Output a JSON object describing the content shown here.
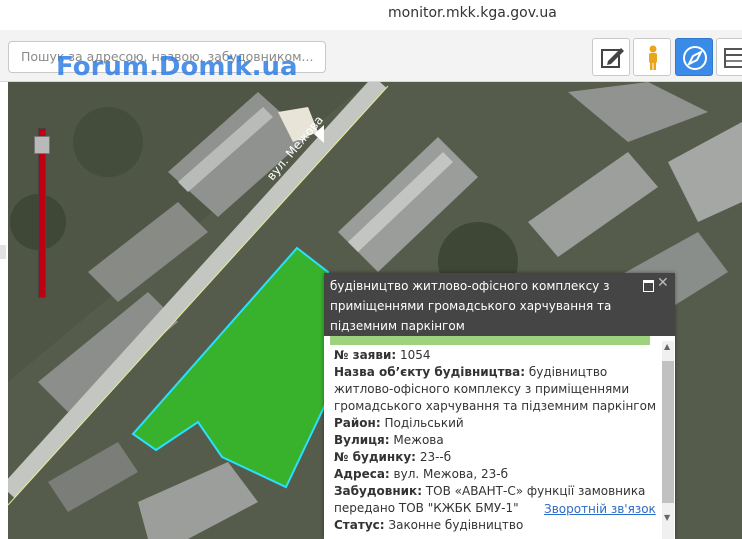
{
  "browser": {
    "url": "monitor.mkk.kga.gov.ua"
  },
  "toolbar": {
    "search_placeholder": "Пошук за адресою, назвою, забудовником...",
    "watermark": "Forum.Domik.ua",
    "buttons": [
      "edit-icon",
      "person-icon",
      "compass-icon",
      "table-icon"
    ],
    "dot_colors": [
      "#3b6fd8",
      "#d6c32a",
      "#d8344c"
    ]
  },
  "map": {
    "street_label": "вул. Межова",
    "polygon_color": "#35b82a",
    "polygon_outline": "#28e1ff"
  },
  "popup": {
    "title": "будівництво житлово-офісного комплексу з приміщеннями громадського харчування та підземним паркінгом",
    "fields": [
      {
        "label": "№ заяви:",
        "value": "1054"
      },
      {
        "label": "Назва об’єкту будівництва:",
        "value": "будівництво житлово-офісного комплексу з приміщеннями громадського харчування та підземним паркінгом"
      },
      {
        "label": "Район:",
        "value": "Подільський"
      },
      {
        "label": "Вулиця:",
        "value": "Межова"
      },
      {
        "label": "№ будинку:",
        "value": "23--б"
      },
      {
        "label": "Адреса:",
        "value": "вул. Межова, 23-б"
      },
      {
        "label": "Забудовник:",
        "value": "ТОВ «АВАНТ-С» функції замовника передано ТОВ \"КЖБК БМУ-1\""
      },
      {
        "label": "Статус:",
        "value": "Законне будівництво"
      }
    ],
    "feedback_link": "Зворотній зв'язок"
  }
}
